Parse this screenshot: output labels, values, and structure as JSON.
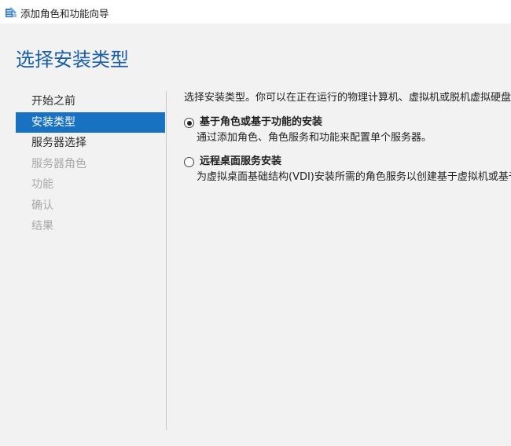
{
  "window": {
    "title": "添加角色和功能向导",
    "icon": "server-manager-icon"
  },
  "page": {
    "title": "选择安装类型"
  },
  "nav": {
    "items": [
      {
        "label": "开始之前",
        "state": "normal"
      },
      {
        "label": "安装类型",
        "state": "active"
      },
      {
        "label": "服务器选择",
        "state": "normal"
      },
      {
        "label": "服务器角色",
        "state": "disabled"
      },
      {
        "label": "功能",
        "state": "disabled"
      },
      {
        "label": "确认",
        "state": "disabled"
      },
      {
        "label": "结果",
        "state": "disabled"
      }
    ]
  },
  "content": {
    "intro": "选择安装类型。你可以在正在运行的物理计算机、虚拟机或脱机虚拟硬盘",
    "options": [
      {
        "label": "基于角色或基于功能的安装",
        "description": "通过添加角色、角色服务和功能来配置单个服务器。",
        "selected": true
      },
      {
        "label": "远程桌面服务安装",
        "description": "为虚拟桌面基础结构(VDI)安装所需的角色服务以创建基于虚拟机或基于",
        "selected": false
      }
    ]
  },
  "colors": {
    "accent": "#1971c2",
    "title": "#1a5ea8",
    "background": "#f2f2f2",
    "disabled_text": "#a8a8a8"
  }
}
